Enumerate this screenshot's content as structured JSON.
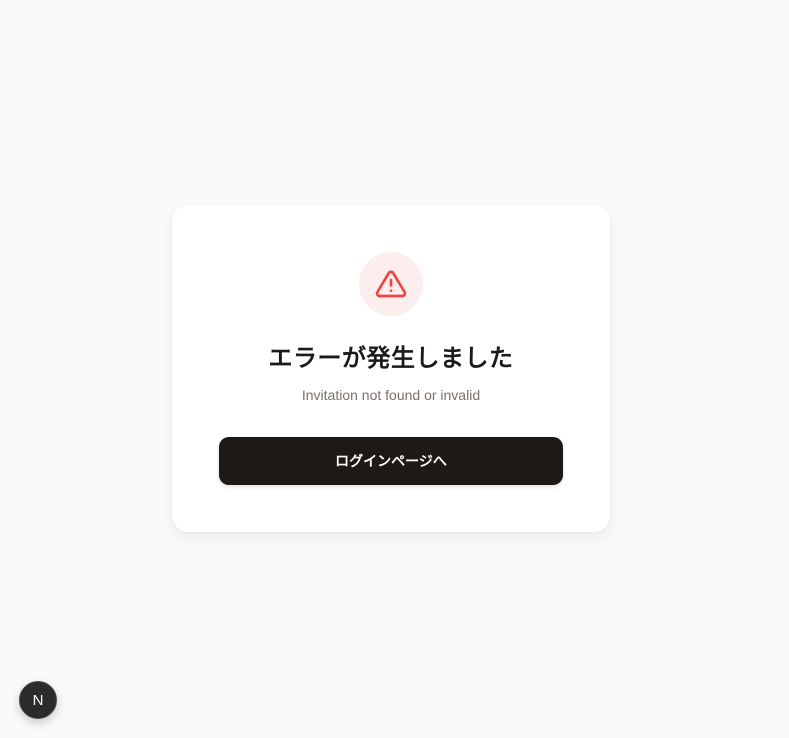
{
  "error": {
    "icon": "warning-triangle-icon",
    "title": "エラーが発生しました",
    "message": "Invitation not found or invalid",
    "button_label": "ログインページへ"
  },
  "dev_badge": {
    "icon": "nextjs-icon",
    "letter": "N"
  },
  "colors": {
    "background": "#fafafa",
    "card": "#ffffff",
    "accent_danger": "#ef4444",
    "icon_bg": "#fdeeee",
    "button_bg": "#1c1917",
    "text_primary": "#1c1917",
    "text_muted": "#78716c"
  }
}
